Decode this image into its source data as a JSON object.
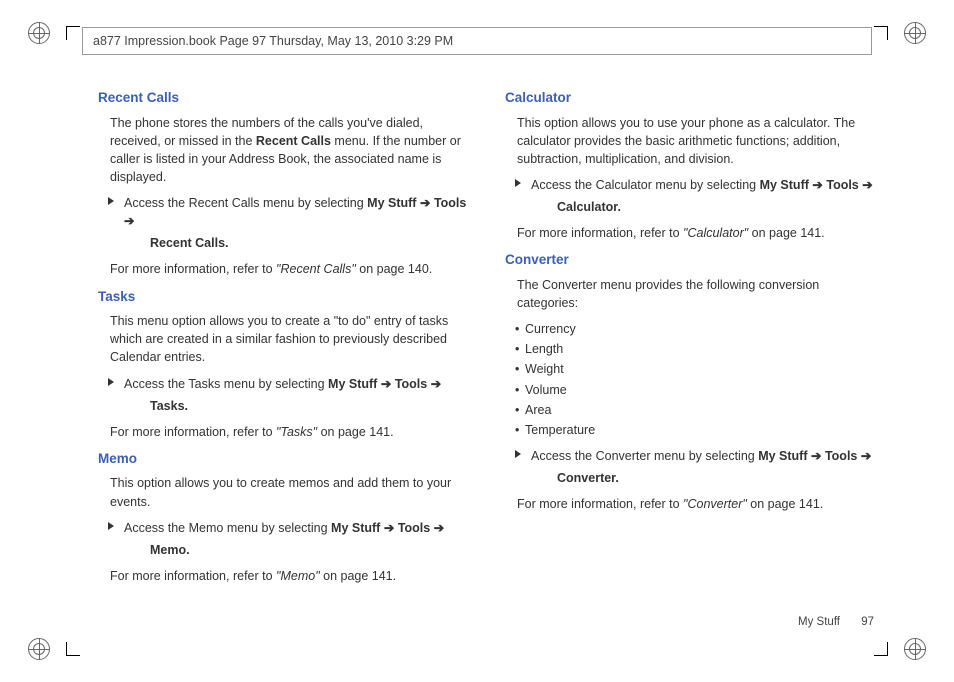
{
  "header": {
    "tag": "a877 Impression.book  Page 97  Thursday, May 13, 2010  3:29 PM"
  },
  "left": {
    "recentCalls": {
      "heading": "Recent Calls",
      "body": "The phone stores the numbers of the calls you've dialed, received, or missed in the ",
      "bodyBold": "Recent Calls",
      "body2": " menu. If the number or caller is listed in your Address Book, the associated name is displayed.",
      "instrPrefix": "Access the Recent Calls menu by selecting ",
      "path1": "My Stuff",
      "arrow": "➔",
      "path2": "Tools",
      "path3": "Recent Calls",
      "period": ".",
      "refPrefix": "For more information, refer to ",
      "refQuoted": "\"Recent Calls\"",
      "refSuffix": "  on page 140."
    },
    "tasks": {
      "heading": "Tasks",
      "body": "This menu option allows you to create a \"to do\" entry of tasks which are created in a similar fashion to previously described Calendar entries.",
      "instrPrefix": "Access the Tasks menu by selecting ",
      "path1": "My Stuff",
      "arrow": "➔",
      "path2": "Tools",
      "path3": "Tasks",
      "period": ".",
      "refPrefix": "For more information, refer to ",
      "refQuoted": "\"Tasks\"",
      "refSuffix": "  on page 141."
    },
    "memo": {
      "heading": "Memo",
      "body": "This option allows you to create memos and add them to your events.",
      "instrPrefix": "Access the Memo menu by selecting ",
      "path1": "My Stuff",
      "arrow": "➔",
      "path2": "Tools",
      "path3": "Memo",
      "period": ".",
      "refPrefix": "For more information, refer to ",
      "refQuoted": "\"Memo\"",
      "refSuffix": "  on page 141."
    }
  },
  "right": {
    "calculator": {
      "heading": "Calculator",
      "body": "This option allows you to use your phone as a calculator. The calculator provides the basic arithmetic functions; addition, subtraction, multiplication, and division.",
      "instrPrefix": "Access the Calculator menu by selecting ",
      "path1": "My Stuff",
      "arrow": "➔",
      "path2": "Tools",
      "path3": "Calculator",
      "period": ".",
      "refPrefix": "For more information, refer to ",
      "refQuoted": "\"Calculator\"",
      "refSuffix": "  on page 141."
    },
    "converter": {
      "heading": "Converter",
      "body": "The Converter menu provides the following conversion categories:",
      "bullets": [
        "Currency",
        "Length",
        "Weight",
        "Volume",
        "Area",
        "Temperature"
      ],
      "instrPrefix": "Access the Converter menu by selecting ",
      "path1": "My Stuff",
      "arrow": "➔",
      "path2": "Tools",
      "path3": "Converter",
      "period": ".",
      "refPrefix": "For more information, refer to ",
      "refQuoted": "\"Converter\"",
      "refSuffix": "  on page 141."
    }
  },
  "footer": {
    "section": "My Stuff",
    "page": "97"
  }
}
